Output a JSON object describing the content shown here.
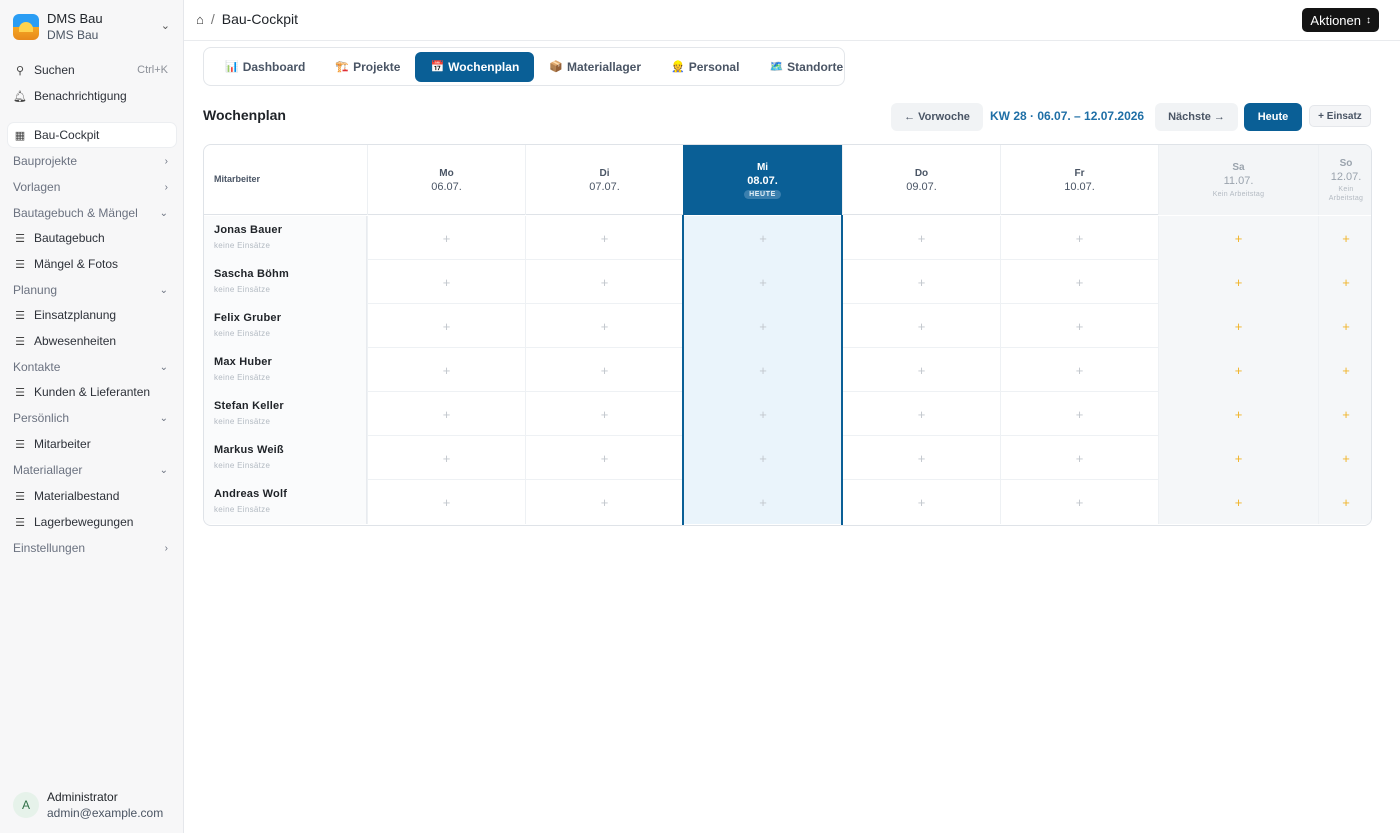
{
  "brand": {
    "name": "DMS Bau",
    "subtitle": "DMS Bau",
    "logo_icon": "construction-logo",
    "chevron_icon": "chevron-updown-icon"
  },
  "sidebar": {
    "search_label": "Suchen",
    "search_shortcut": "Ctrl+K",
    "notifications_label": "Benachrichtigung",
    "cockpit_label": "Bau-Cockpit",
    "groups": {
      "bauprojekte": "Bauprojekte",
      "vorlagen": "Vorlagen",
      "bautagebuch_maengel": "Bautagebuch & Mängel",
      "planung": "Planung",
      "kontakte": "Kontakte",
      "persoenlich": "Persönlich",
      "materiallager": "Materiallager",
      "einstellungen": "Einstellungen"
    },
    "items": {
      "bautagebuch": "Bautagebuch",
      "maengel_fotos": "Mängel & Fotos",
      "einsatzplanung": "Einsatzplanung",
      "abwesenheiten": "Abwesenheiten",
      "kunden_lieferanten": "Kunden & Lieferanten",
      "mitarbeiter": "Mitarbeiter",
      "materialbestand": "Materialbestand",
      "lagerbewegungen": "Lagerbewegungen"
    }
  },
  "user": {
    "initial": "A",
    "name": "Administrator",
    "email": "admin@example.com"
  },
  "breadcrumb": {
    "separator": "/",
    "current": "Bau-Cockpit"
  },
  "header": {
    "actions_label": "Aktionen"
  },
  "tabs": [
    {
      "icon": "📊",
      "label": "Dashboard"
    },
    {
      "icon": "🏗️",
      "label": "Projekte"
    },
    {
      "icon": "📅",
      "label": "Wochenplan"
    },
    {
      "icon": "📦",
      "label": "Materiallager"
    },
    {
      "icon": "👷",
      "label": "Personal"
    },
    {
      "icon": "🗺️",
      "label": "Standorte"
    }
  ],
  "week": {
    "title": "Wochenplan",
    "prev_label": "← Vorwoche",
    "range_label": "KW 28 · 06.07. – 12.07.2026",
    "next_label": "Nächste →",
    "today_label": "Heute",
    "add_label": "+ Einsatz"
  },
  "grid": {
    "employee_header": "Mitarbeiter",
    "today_badge": "HEUTE",
    "off_label": "Kein Arbeitstag",
    "off_label_line1": "Kein",
    "off_label_line2": "Arbeitstag",
    "days": [
      {
        "day": "Mo",
        "date": "06.07."
      },
      {
        "day": "Di",
        "date": "07.07."
      },
      {
        "day": "Mi",
        "date": "08.07."
      },
      {
        "day": "Do",
        "date": "09.07."
      },
      {
        "day": "Fr",
        "date": "10.07."
      },
      {
        "day": "Sa",
        "date": "11.07."
      },
      {
        "day": "So",
        "date": "12.07."
      }
    ],
    "add_symbol": "+",
    "employees": [
      {
        "name": "Jonas Bauer",
        "status": "keine Einsätze"
      },
      {
        "name": "Sascha Böhm",
        "status": "keine Einsätze"
      },
      {
        "name": "Felix Gruber",
        "status": "keine Einsätze"
      },
      {
        "name": "Max Huber",
        "status": "keine Einsätze"
      },
      {
        "name": "Stefan Keller",
        "status": "keine Einsätze"
      },
      {
        "name": "Markus Weiß",
        "status": "keine Einsätze"
      },
      {
        "name": "Andreas Wolf",
        "status": "keine Einsätze"
      }
    ]
  },
  "colors": {
    "primary": "#0a5f96",
    "weekend_plus": "#f0b429",
    "today_bg": "#eaf4fb"
  }
}
